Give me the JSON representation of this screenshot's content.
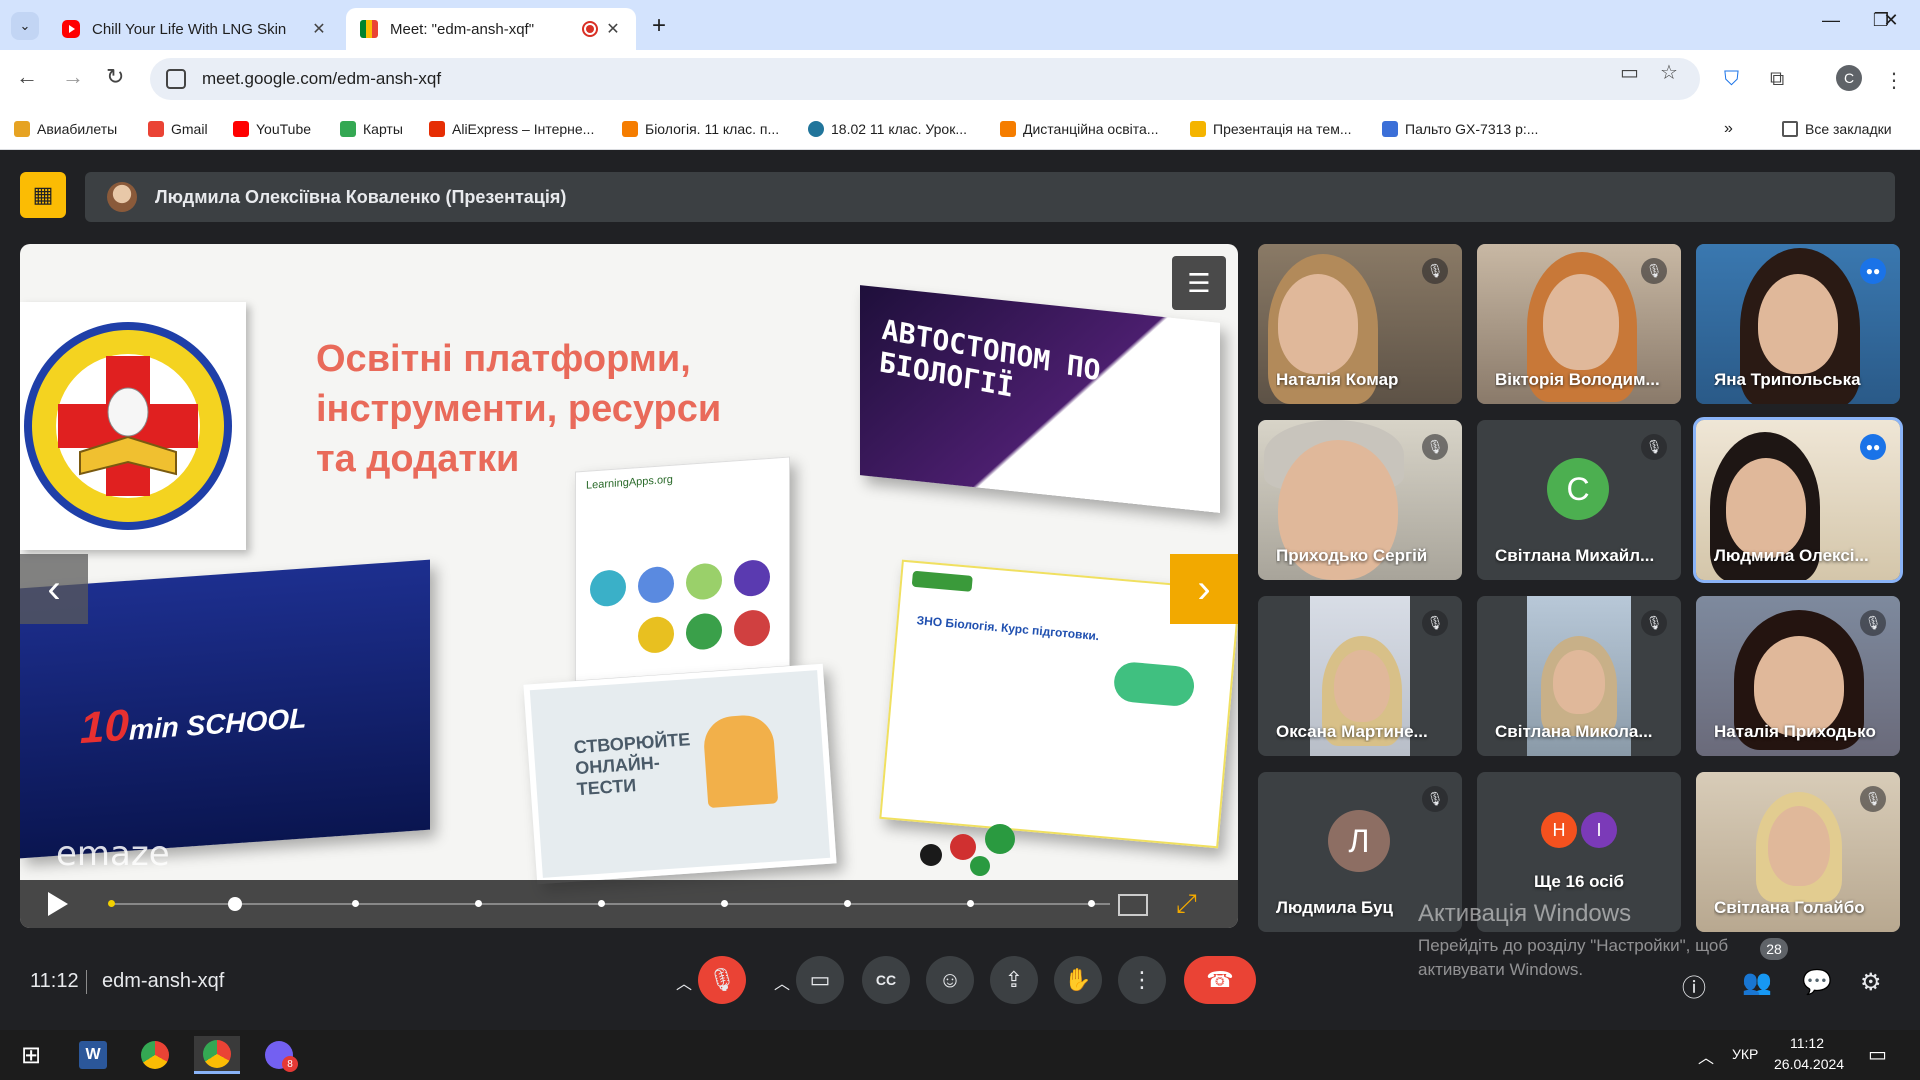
{
  "browser": {
    "tabs": [
      {
        "title": "Chill Your Life With LNG Skin",
        "favicon": "youtube-icon",
        "active": false
      },
      {
        "title": "Meet: \"edm-ansh-xqf\"",
        "favicon": "meet-icon",
        "active": true,
        "recording": true
      }
    ],
    "url": "meet.google.com/edm-ansh-xqf",
    "profile_initial": "C",
    "bookmarks": [
      {
        "label": "Авиабилеты",
        "icon": "tickets-icon",
        "color": "#e6a323"
      },
      {
        "label": "Gmail",
        "icon": "gmail-icon",
        "color": "#ea4335"
      },
      {
        "label": "YouTube",
        "icon": "youtube-icon",
        "color": "#ff0000"
      },
      {
        "label": "Карты",
        "icon": "maps-icon",
        "color": "#34a853"
      },
      {
        "label": "AliExpress – Інтерне...",
        "icon": "aliexpress-icon",
        "color": "#e62e04"
      },
      {
        "label": "Біологія. 11 клас. п...",
        "icon": "blogger-icon",
        "color": "#f57d00"
      },
      {
        "label": "18.02 11 клас. Урок...",
        "icon": "wordpress-icon",
        "color": "#21759b"
      },
      {
        "label": "Дистанційна освіта...",
        "icon": "blogger-icon",
        "color": "#f57d00"
      },
      {
        "label": "Презентація на тем...",
        "icon": "slides-icon",
        "color": "#f4b400"
      },
      {
        "label": "Пальто GX-7313 р:...",
        "icon": "shop-icon",
        "color": "#3b6fd8"
      }
    ],
    "all_bookmarks_label": "Все закладки"
  },
  "meet": {
    "presenter_banner": "Людмила Олексіївна Коваленко (Презентація)",
    "slide": {
      "title_lines": [
        "Освітні платформи,",
        "інструменти, ресурси",
        "та додатки"
      ],
      "thumb_purple_text": "АВТОСТОПОМ ПО БІОЛОГІЇ",
      "thumb_school_brand": "10",
      "thumb_school_text": "min SCHOOL",
      "thumb_tests_text": "СТВОРЮЙТЕ ОНЛАЙН-ТЕСТИ",
      "thumb_smart_text": "ЗНО Біологія. Курс підготовки.",
      "thumb_learning_text": "LearningApps.org",
      "watermark": "emaze",
      "progress_position": 1,
      "progress_dots": 9
    },
    "participants": [
      {
        "name": "Наталія Комар",
        "muted": true,
        "type": "video"
      },
      {
        "name": "Вікторія Володим...",
        "muted": true,
        "type": "video"
      },
      {
        "name": "Яна Трипольська",
        "muted": false,
        "speaking": false,
        "type": "video"
      },
      {
        "name": "Приходько Сергій",
        "muted": true,
        "type": "video"
      },
      {
        "name": "Світлана Михайл...",
        "muted": true,
        "type": "avatar",
        "initial": "С",
        "avatar_color": "#4caf50"
      },
      {
        "name": "Людмила Олексі...",
        "muted": false,
        "speaking": true,
        "type": "video"
      },
      {
        "name": "Оксана Мартине...",
        "muted": true,
        "type": "video"
      },
      {
        "name": "Світлана Микола...",
        "muted": true,
        "type": "video"
      },
      {
        "name": "Наталія Приходько",
        "muted": true,
        "type": "video"
      },
      {
        "name": "Людмила Буц",
        "muted": true,
        "type": "avatar",
        "initial": "Л",
        "avatar_color": "#8d6e63"
      },
      {
        "name": "Ще 16 осіб",
        "type": "overflow",
        "initials": [
          "Н",
          "І"
        ],
        "colors": [
          "#f4511e",
          "#7b3ab8"
        ]
      },
      {
        "name": "Світлана Голайбо",
        "muted": true,
        "type": "video"
      }
    ],
    "time": "11:12",
    "meeting_code": "edm-ansh-xqf",
    "participant_count": "28",
    "windows_activation": {
      "title": "Активація Windows",
      "subtitle": "Перейдіть до розділу \"Настройки\", щоб активувати Windows."
    }
  },
  "taskbar": {
    "language": "УКР",
    "time": "11:12",
    "date": "26.04.2024",
    "viber_badge": "8"
  },
  "colors": {
    "meet_bg": "#202124",
    "tile_bg": "#3c4043",
    "end_call": "#ea4335",
    "present_yellow": "#fbbc04",
    "slide_title": "#e96a5a"
  }
}
